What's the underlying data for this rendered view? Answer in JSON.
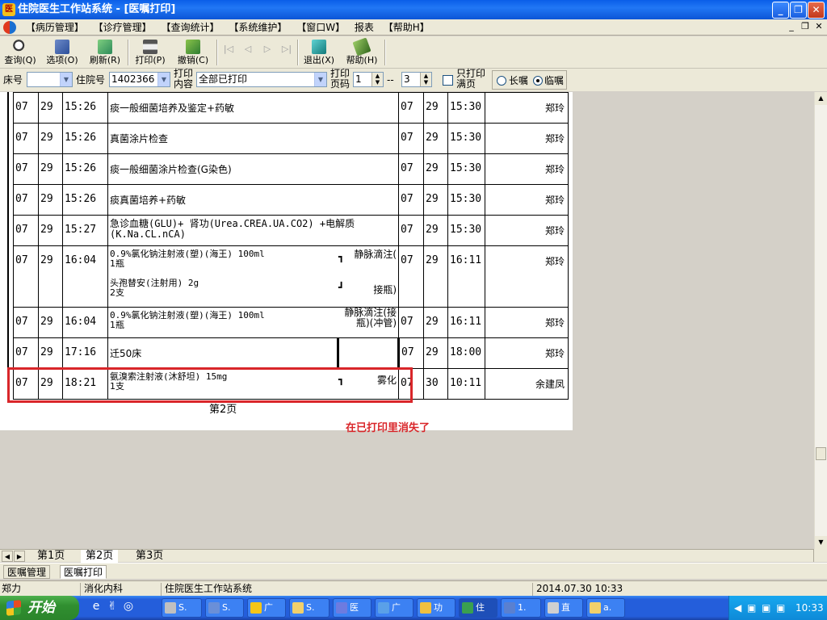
{
  "window": {
    "title": "住院医生工作站系统 - [医嘱打印]",
    "min_icon": "minimize-icon",
    "max_icon": "restore-icon",
    "close_icon": "close-icon"
  },
  "menu": {
    "items": [
      "【病历管理】",
      "【诊疗管理】",
      "【查询统计】",
      "【系统维护】",
      "【窗口W】",
      "报表",
      "【帮助H】"
    ]
  },
  "toolbar": {
    "query": "查询(Q)",
    "options": "选项(O)",
    "refresh": "刷新(R)",
    "print": "打印(P)",
    "undo": "撤销(C)",
    "exit": "退出(X)",
    "help": "帮助(H)"
  },
  "filters": {
    "bed_label": "床号",
    "bed_value": "",
    "inpatient_label": "住院号",
    "inpatient_value": "1402366",
    "content_label": "打印内容",
    "content_value": "全部已打印",
    "page_label": "打印页码",
    "page_from": "1",
    "page_sep": "--",
    "page_to": "3",
    "full_only_label": "只打印满页",
    "long_label": "长嘱",
    "temp_label": "临嘱"
  },
  "orders": [
    {
      "m": "07",
      "d": "29",
      "t": "15:26",
      "text": "痰一般细菌培养及鉴定+药敏",
      "m2": "07",
      "d2": "29",
      "t2": "15:30",
      "sig": "郑玲"
    },
    {
      "m": "07",
      "d": "29",
      "t": "15:26",
      "text": "真菌涂片检查",
      "m2": "07",
      "d2": "29",
      "t2": "15:30",
      "sig": "郑玲"
    },
    {
      "m": "07",
      "d": "29",
      "t": "15:26",
      "text": "痰一般细菌涂片检查(G染色)",
      "m2": "07",
      "d2": "29",
      "t2": "15:30",
      "sig": "郑玲"
    },
    {
      "m": "07",
      "d": "29",
      "t": "15:26",
      "text": "痰真菌培养+药敏",
      "m2": "07",
      "d2": "29",
      "t2": "15:30",
      "sig": "郑玲"
    },
    {
      "m": "07",
      "d": "29",
      "t": "15:27",
      "text": "急诊血糖(GLU)+ 肾功(Urea.CREA.UA.CO2) +电解质(K.Na.CL.nCA)",
      "m2": "07",
      "d2": "29",
      "t2": "15:30",
      "sig": "郑玲"
    }
  ],
  "group_order": {
    "m": "07",
    "d": "29",
    "t": "16:04",
    "drug1": "0.9%氯化钠注射液(塑)(海王)  100ml",
    "drug1_qty": "1瓶",
    "drug2": "头孢替安(注射用)  2g",
    "drug2_qty": "2支",
    "route_top": "静脉滴注(",
    "route_bottom": "接瓶)",
    "m2": "07",
    "d2": "29",
    "t2": "16:11",
    "sig": "郑玲"
  },
  "single_drip": {
    "m": "07",
    "d": "29",
    "t": "16:04",
    "drug": "0.9%氯化钠注射液(塑)(海王)  100ml",
    "qty": "1瓶",
    "route": "静脉滴注(接瓶)(冲管)",
    "m2": "07",
    "d2": "29",
    "t2": "16:11",
    "sig": "郑玲"
  },
  "transfer": {
    "m": "07",
    "d": "29",
    "t": "17:16",
    "text": "迁50床",
    "m2": "07",
    "d2": "29",
    "t2": "18:00",
    "sig": "郑玲"
  },
  "highlight": {
    "m": "07",
    "d": "29",
    "t": "18:21",
    "drug": "氨溴索注射液(沐舒坦)  15mg",
    "qty": "1支",
    "route": "雾化",
    "m2": "07",
    "d2": "30",
    "t2": "10:11",
    "sig": "余建凤"
  },
  "page_label": "第2页",
  "annotation": "在已打印里消失了",
  "page_tabs": [
    "第1页",
    "第2页",
    "第3页"
  ],
  "active_page_tab": 1,
  "mdi_tabs": [
    "医嘱管理",
    "医嘱打印"
  ],
  "status": {
    "user": "郑力",
    "dept": "消化内科",
    "system": "住院医生工作站系统",
    "datetime": "2014.07.30 10:33"
  },
  "taskbar": {
    "start": "开始",
    "tasks": [
      "S.",
      "S.",
      "广",
      "S.",
      "医",
      "广",
      "功",
      "住",
      "1.",
      "直",
      "a."
    ],
    "clock": "10:33"
  }
}
